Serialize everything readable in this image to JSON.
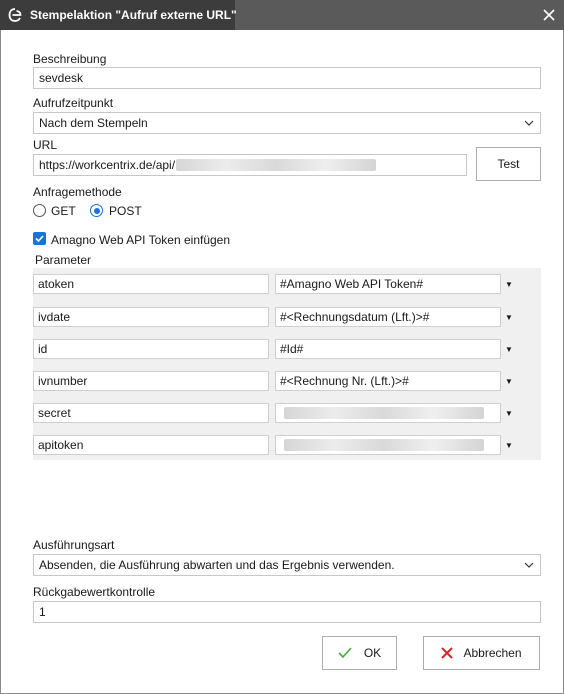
{
  "window": {
    "title": "Stempelaktion \"Aufruf externe URL\""
  },
  "form": {
    "beschreibung_label": "Beschreibung",
    "beschreibung_value": "sevdesk",
    "aufrufzeitpunkt_label": "Aufrufzeitpunkt",
    "aufrufzeitpunkt_value": "Nach dem Stempeln",
    "url_label": "URL",
    "url_value": "https://workcentrix.de/api/",
    "test_button": "Test",
    "anfragemethode_label": "Anfragemethode",
    "method_get": "GET",
    "method_post": "POST",
    "method_selected": "POST",
    "token_checkbox_label": "Amagno Web API Token einfügen",
    "token_checkbox_checked": true,
    "parameter_label": "Parameter",
    "ausfuehrungsart_label": "Ausführungsart",
    "ausfuehrungsart_value": "Absenden, die Ausführung abwarten und das Ergebnis verwenden.",
    "rueckgabe_label": "Rückgabewertkontrolle",
    "rueckgabe_value": "1"
  },
  "parameters": [
    {
      "name": "atoken",
      "value": "#Amagno Web API Token#"
    },
    {
      "name": "ivdate",
      "value": "#<Rechnungsdatum (Lft.)>#"
    },
    {
      "name": "id",
      "value": "#Id#"
    },
    {
      "name": "ivnumber",
      "value": "#<Rechnung Nr. (Lft.)>#"
    },
    {
      "name": "secret",
      "value": ""
    },
    {
      "name": "apitoken",
      "value": ""
    }
  ],
  "footer": {
    "ok_label": "OK",
    "cancel_label": "Abbrechen"
  },
  "colors": {
    "title_dark": "#3c3c3c",
    "title_mid": "#5a5a5a",
    "accent_blue": "#1a73d9",
    "ok_green": "#3fae3f",
    "cancel_red": "#d8262b"
  }
}
